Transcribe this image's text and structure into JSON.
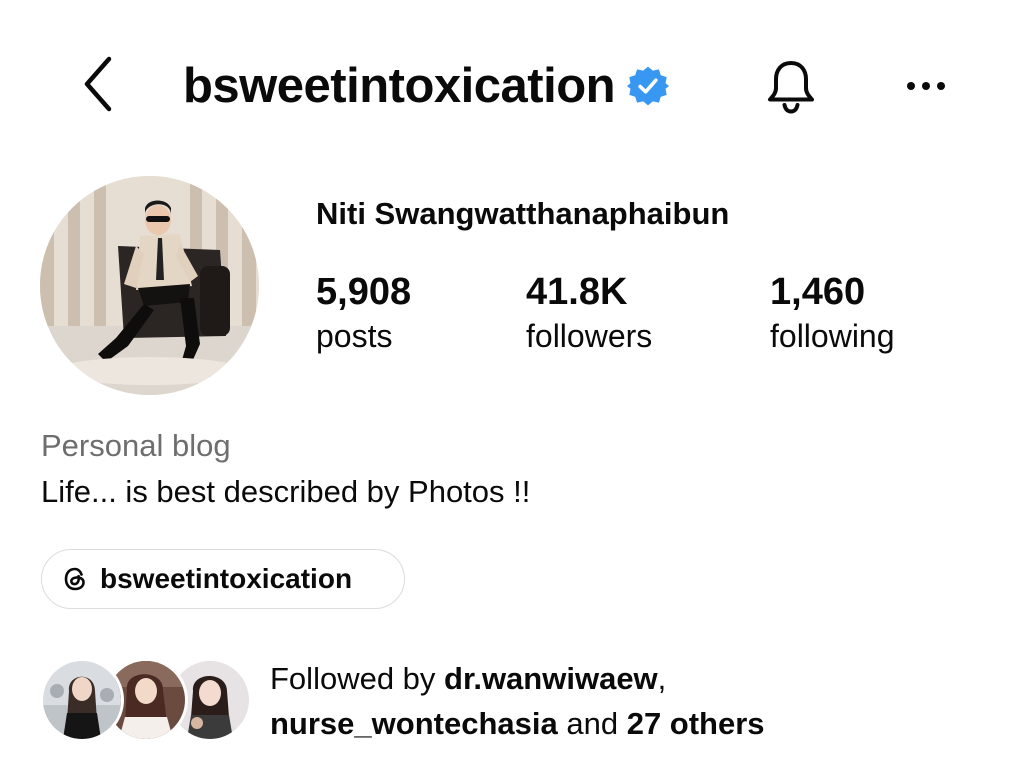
{
  "header": {
    "username": "bsweetintoxication",
    "back_icon": "chevron-left-icon",
    "verified_icon": "verified-badge-icon",
    "verified_color": "#3897f0",
    "notification_icon": "bell-icon",
    "more_icon": "more-horizontal-icon"
  },
  "profile": {
    "full_name": "Niti Swangwatthanaphaibun",
    "stats": {
      "posts": {
        "value": "5,908",
        "label": "posts"
      },
      "followers": {
        "value": "41.8K",
        "label": "followers"
      },
      "following": {
        "value": "1,460",
        "label": "following"
      }
    },
    "category": "Personal blog",
    "bio": "Life... is best described by Photos !!",
    "threads_link": {
      "icon": "threads-icon",
      "label": "bsweetintoxication"
    }
  },
  "mutual": {
    "prefix": "Followed by",
    "user1": "dr.wanwiwaew",
    "comma": ",",
    "user2": "nurse_wontechasia",
    "joiner": "and",
    "others": "27 others"
  }
}
